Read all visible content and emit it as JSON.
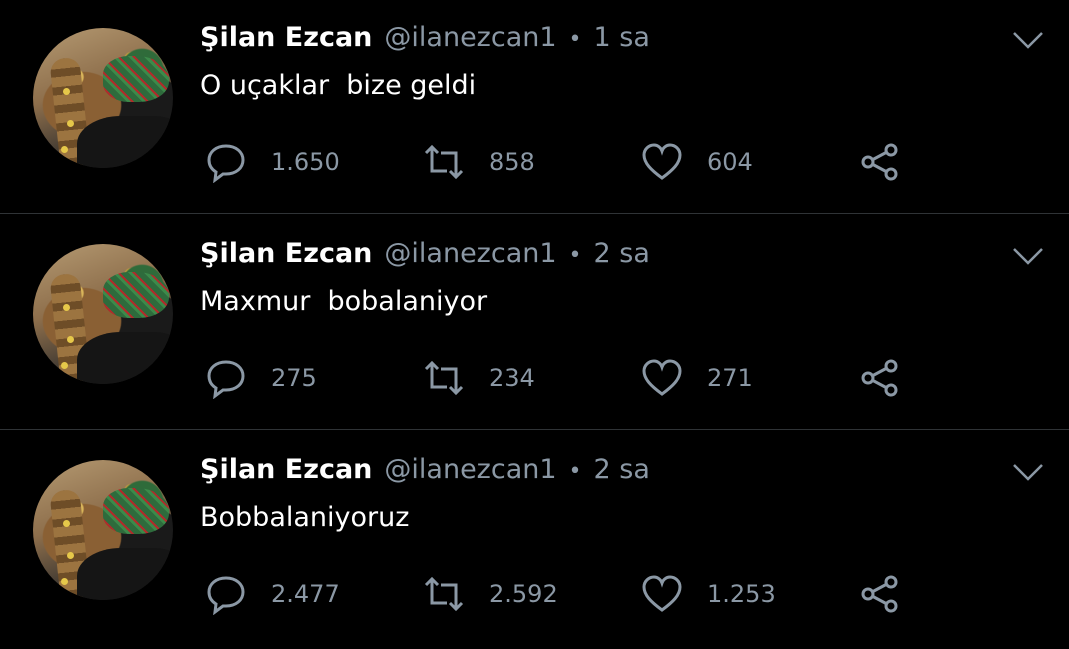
{
  "tweets": [
    {
      "name": "Şilan Ezcan",
      "handle": "@ilanezcan1",
      "separator": "•",
      "time": "1 sa",
      "text": "O uçaklar  bize geldi",
      "replies": "1.650",
      "retweets": "858",
      "likes": "604"
    },
    {
      "name": "Şilan Ezcan",
      "handle": "@ilanezcan1",
      "separator": "•",
      "time": "2 sa",
      "text": "Maxmur  bobalaniyor",
      "replies": "275",
      "retweets": "234",
      "likes": "271"
    },
    {
      "name": "Şilan Ezcan",
      "handle": "@ilanezcan1",
      "separator": "•",
      "time": "2 sa",
      "text": "Bobbalaniyoruz",
      "replies": "2.477",
      "retweets": "2.592",
      "likes": "1.253"
    }
  ],
  "icons": {
    "reply": "reply-icon",
    "retweet": "retweet-icon",
    "like": "like-icon",
    "share": "share-icon",
    "menu": "chevron-down-icon"
  },
  "colors": {
    "background": "#000000",
    "text": "#ffffff",
    "muted": "#8b98a5",
    "divider": "#2f3336"
  }
}
